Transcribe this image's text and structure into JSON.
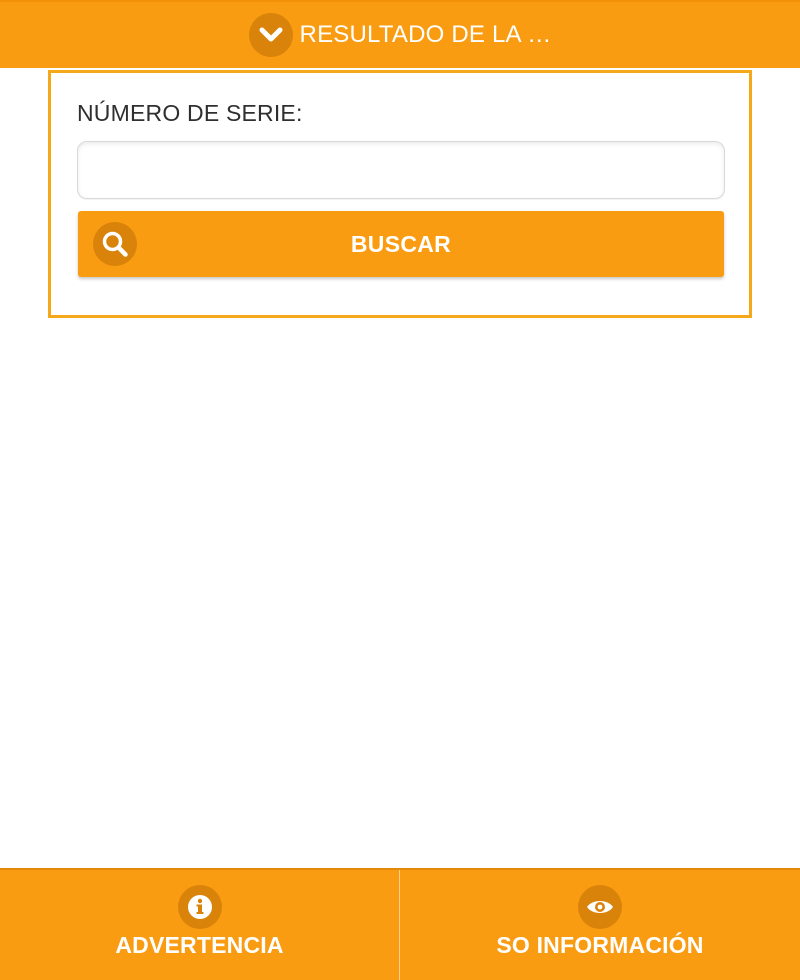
{
  "header": {
    "title": "RESULTADO DE LA …",
    "icon": "chevron-down-icon"
  },
  "form": {
    "label": "NÚMERO DE SERIE:",
    "input_value": "",
    "input_placeholder": "",
    "search_label": "BUSCAR",
    "search_icon": "search-icon"
  },
  "footer": {
    "warning_label": "ADVERTENCIA",
    "warning_icon": "info-icon",
    "info_label": "SO INFORMACIÓN",
    "info_icon": "eye-icon"
  },
  "colors": {
    "accent": "#fa9c12",
    "accent_dark": "#d9830a",
    "panel_border": "#f5a91a",
    "text_dark": "#2f2f2f"
  }
}
